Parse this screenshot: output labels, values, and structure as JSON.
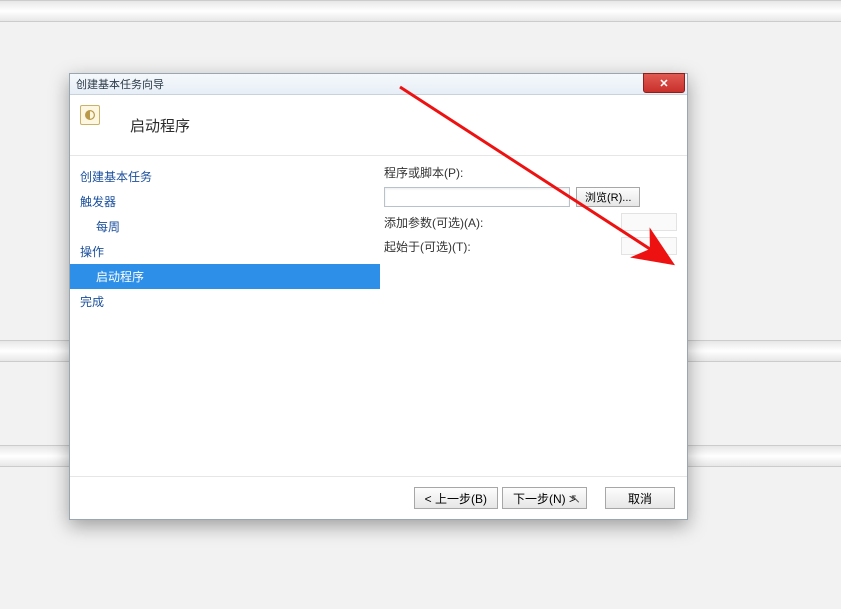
{
  "window": {
    "title": "创建基本任务向导"
  },
  "header": {
    "page_title": "启动程序"
  },
  "nav": {
    "create": "创建基本任务",
    "trigger": "触发器",
    "trigger_weekly": "每周",
    "action": "操作",
    "action_start": "启动程序",
    "finish": "完成"
  },
  "form": {
    "program_label": "程序或脚本(P):",
    "args_label": "添加参数(可选)(A):",
    "startin_label": "起始于(可选)(T):",
    "browse": "浏览(R)..."
  },
  "footer": {
    "back": "< 上一步(B)",
    "next": "下一步(N) >",
    "cancel": "取消"
  }
}
